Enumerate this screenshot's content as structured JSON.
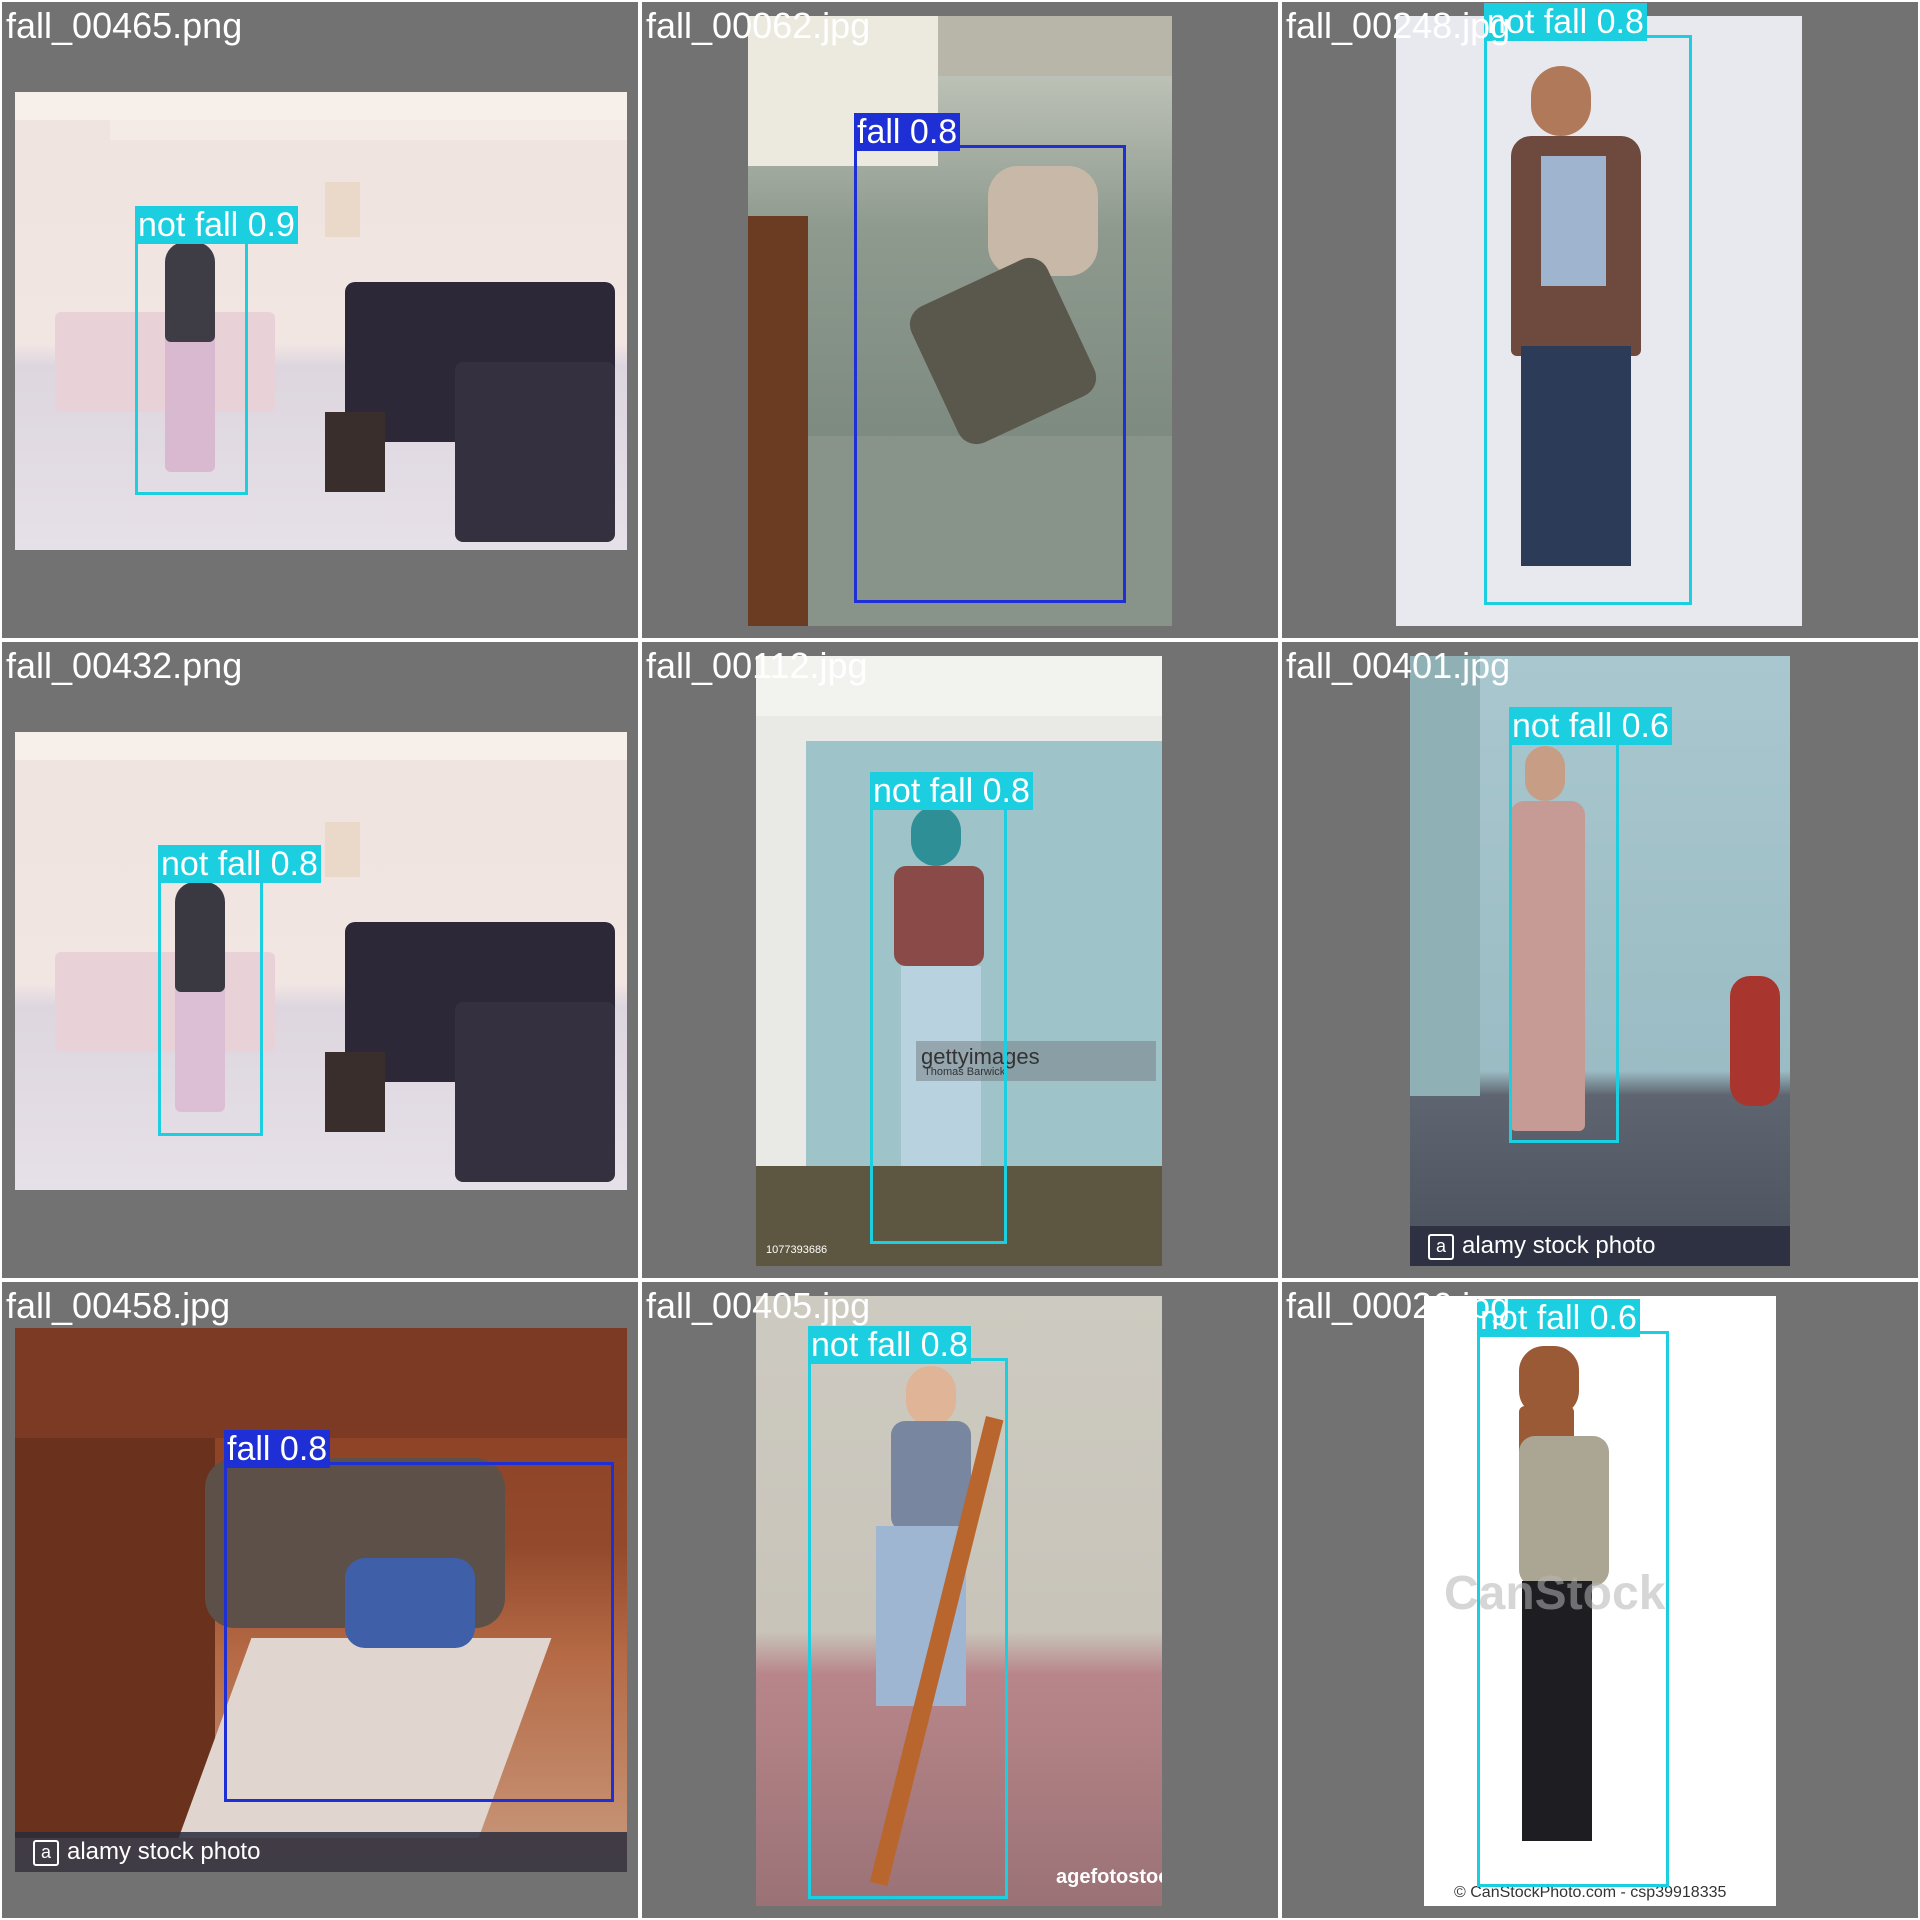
{
  "colors": {
    "background": "#727272",
    "fall": "#1f2fd6",
    "not_fall": "#1ccfe0"
  },
  "tiles": [
    {
      "filename": "fall_00465.png",
      "detections": [
        {
          "label": "not fall 0.9",
          "class": "not fall",
          "confidence": 0.9
        }
      ]
    },
    {
      "filename": "fall_00062.jpg",
      "detections": [
        {
          "label": "fall 0.8",
          "class": "fall",
          "confidence": 0.8
        }
      ]
    },
    {
      "filename": "fall_00248.jpg",
      "detections": [
        {
          "label": "not fall 0.8",
          "class": "not fall",
          "confidence": 0.8
        }
      ]
    },
    {
      "filename": "fall_00432.png",
      "detections": [
        {
          "label": "not fall 0.8",
          "class": "not fall",
          "confidence": 0.8
        }
      ]
    },
    {
      "filename": "fall_00112.jpg",
      "watermark": "gettyimages",
      "watermark_credit": "Thomas Barwick",
      "stock_id": "1077393686",
      "detections": [
        {
          "label": "not fall 0.8",
          "class": "not fall",
          "confidence": 0.8
        }
      ]
    },
    {
      "filename": "fall_00401.jpg",
      "watermark_bar": "alamy stock photo",
      "detections": [
        {
          "label": "not fall 0.6",
          "class": "not fall",
          "confidence": 0.6
        }
      ]
    },
    {
      "filename": "fall_00458.jpg",
      "watermark_bar": "alamy stock photo",
      "detections": [
        {
          "label": "fall 0.8",
          "class": "fall",
          "confidence": 0.8
        }
      ]
    },
    {
      "filename": "fall_00405.jpg",
      "watermark": "agefotostock",
      "detections": [
        {
          "label": "not fall 0.8",
          "class": "not fall",
          "confidence": 0.8
        }
      ]
    },
    {
      "filename": "fall_00026.jpg",
      "watermark": "CanStock",
      "watermark_footer": "© CanStockPhoto.com - csp39918335",
      "detections": [
        {
          "label": "not fall 0.6",
          "class": "not fall",
          "confidence": 0.6
        }
      ]
    }
  ]
}
